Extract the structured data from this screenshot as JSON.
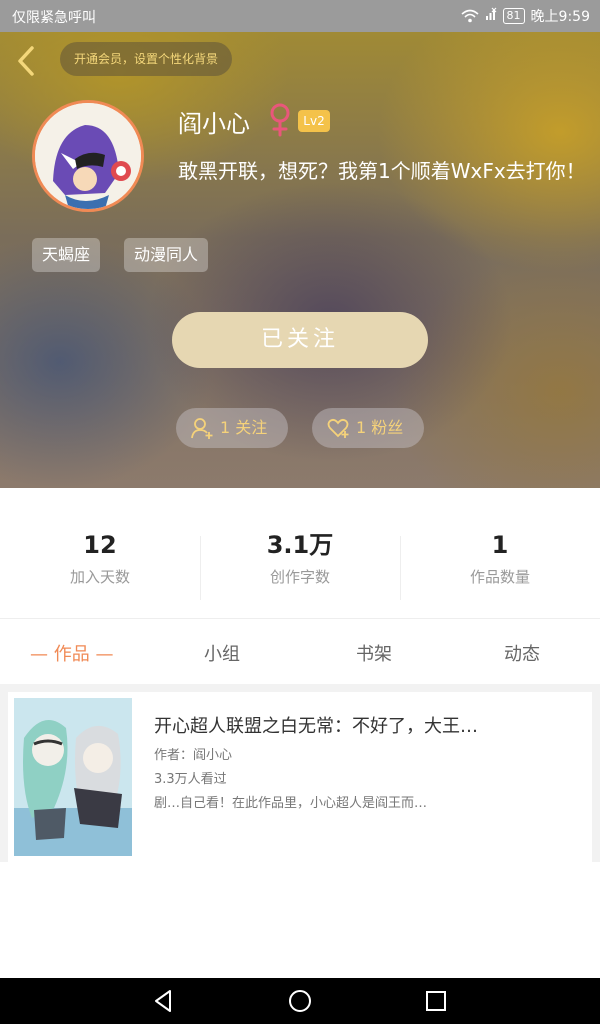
{
  "status_bar": {
    "carrier": "仅限紧急呼叫",
    "battery": "81",
    "time": "晚上9:59"
  },
  "header": {
    "vip_prompt": "开通会员，设置个性化背景"
  },
  "profile": {
    "name": "阎小心",
    "level": "Lv2",
    "signature": "敢黑开联，想死？我第1个顺着WxFx去打你！",
    "tags": [
      "天蝎座",
      "动漫同人"
    ],
    "follow_button": "已关注",
    "following": "1 关注",
    "fans": "1 粉丝"
  },
  "stats": [
    {
      "value": "12",
      "label": "加入天数"
    },
    {
      "value": "3.1万",
      "label": "创作字数"
    },
    {
      "value": "1",
      "label": "作品数量"
    }
  ],
  "tabs": [
    {
      "label": "— 作品 —"
    },
    {
      "label": "小组"
    },
    {
      "label": "书架"
    },
    {
      "label": "动态"
    }
  ],
  "works": [
    {
      "title": "开心超人联盟之白无常：不好了，大王…",
      "author": "作者：阎小心",
      "reads": "3.3万人看过",
      "desc": "剧…自己看！在此作品里，小心超人是阎王而…"
    }
  ],
  "colors": {
    "accent": "#f08a55",
    "gold": "#f5d27a",
    "follow_button": "#e6d7b2",
    "level_badge": "#f4c24a"
  }
}
